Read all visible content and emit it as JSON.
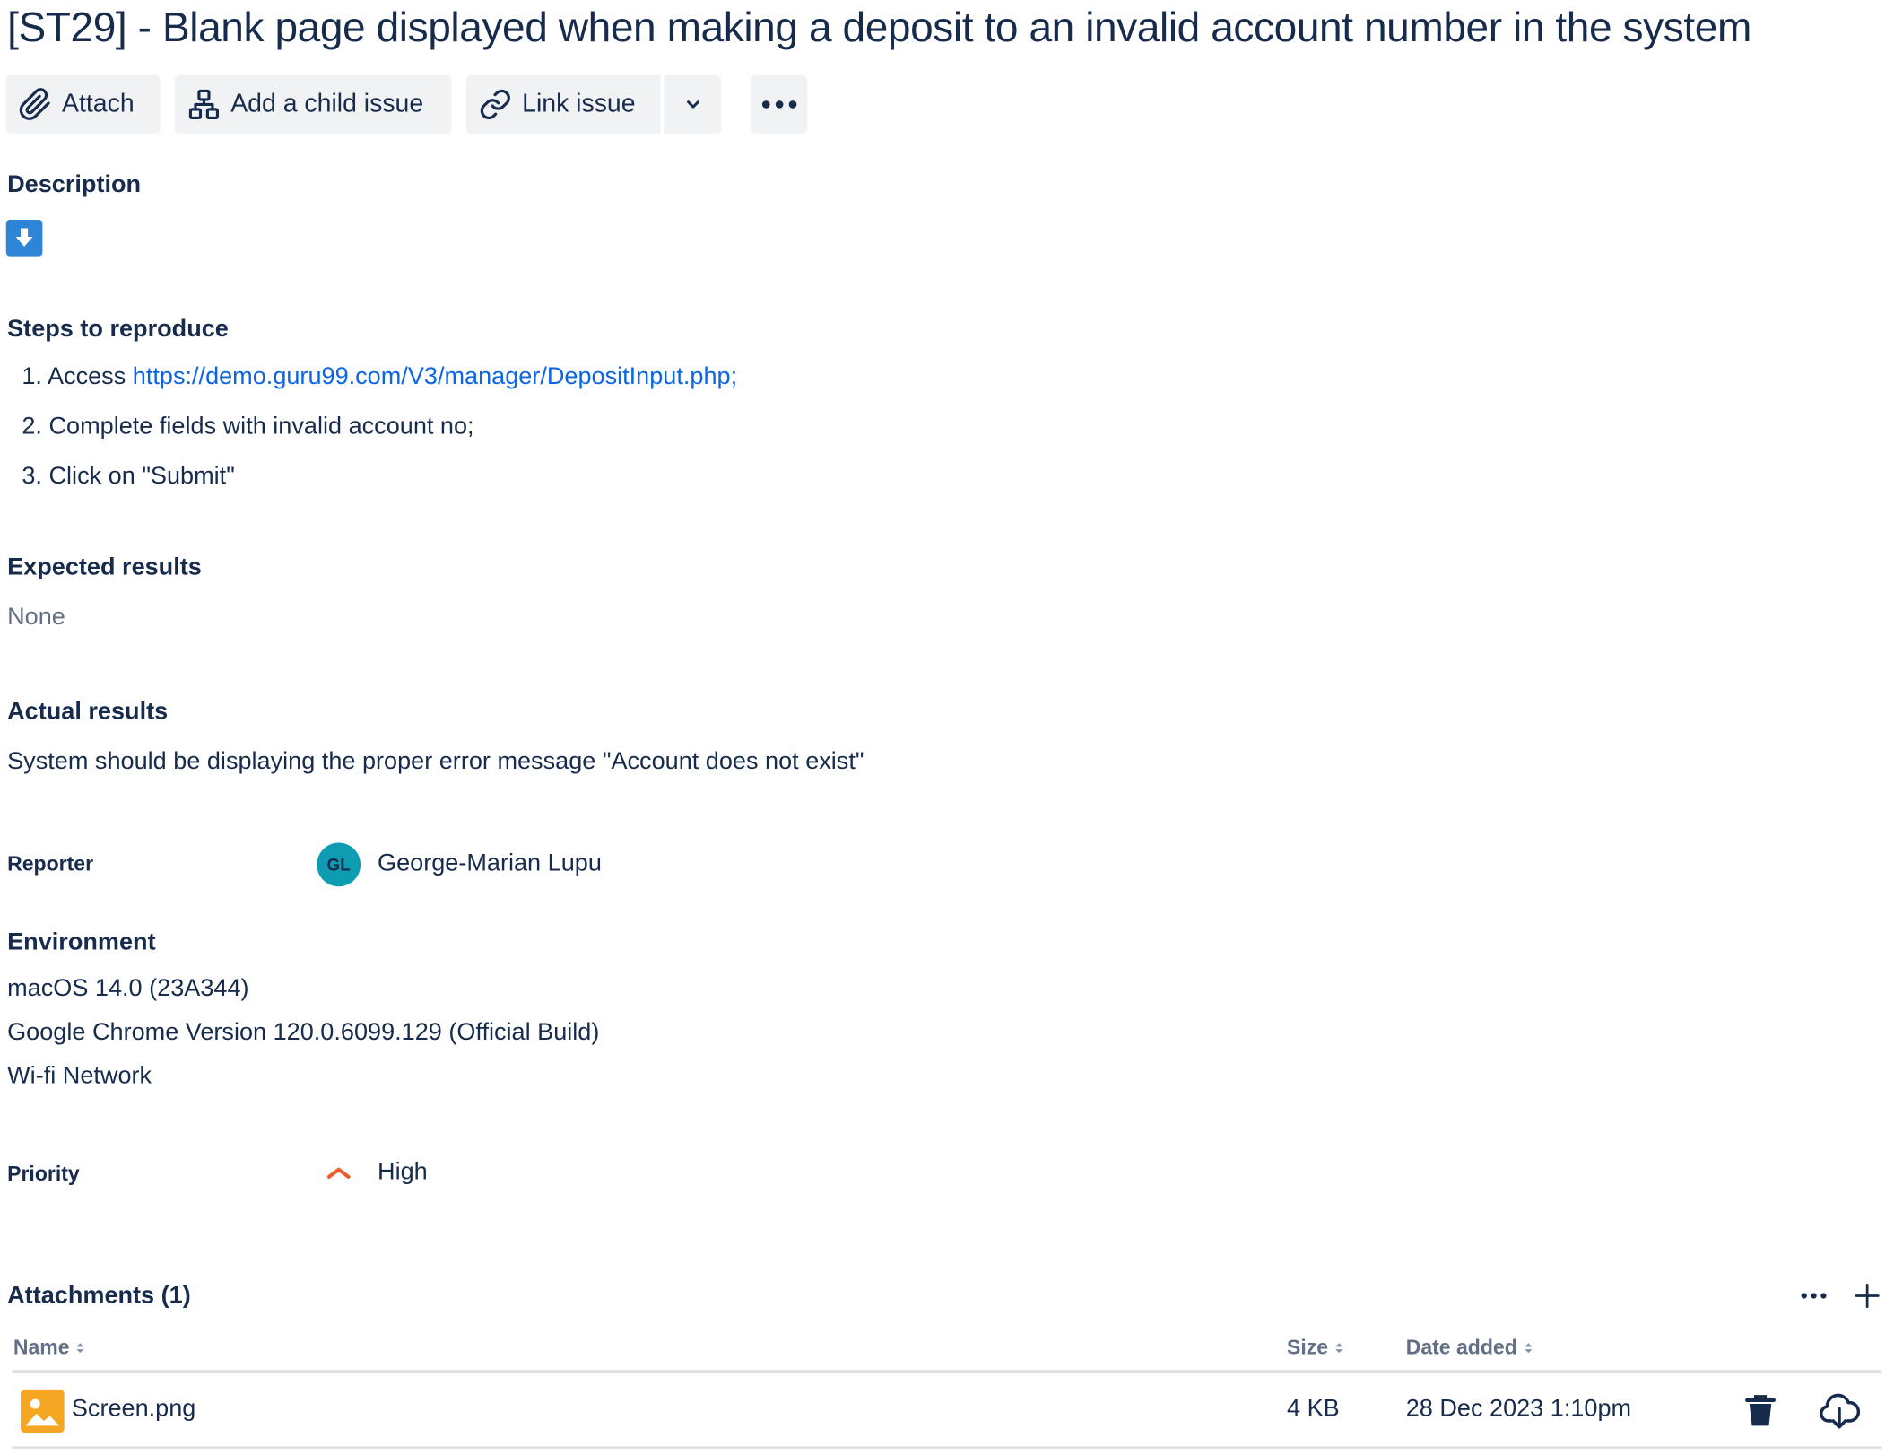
{
  "issue": {
    "title": "[ST29] - Blank page displayed when making a deposit to an invalid account number in the system"
  },
  "toolbar": {
    "attach_label": "Attach",
    "add_child_label": "Add a child issue",
    "link_issue_label": "Link issue"
  },
  "description": {
    "heading": "Description",
    "icon": "download-arrow-icon"
  },
  "steps": {
    "heading": "Steps to reproduce",
    "items": [
      {
        "num": "1.",
        "text": "Access ",
        "link": "https://demo.guru99.com/V3/manager/DepositInput.php;"
      },
      {
        "num": "2.",
        "text": "Complete fields with invalid account no;"
      },
      {
        "num": "3.",
        "text": "Click on \"Submit\""
      }
    ]
  },
  "expected": {
    "heading": "Expected results",
    "value": "None"
  },
  "actual": {
    "heading": "Actual results",
    "value": "System should be displaying the proper error message \"Account does not exist\""
  },
  "reporter": {
    "label": "Reporter",
    "initials": "GL",
    "name": "George-Marian Lupu",
    "avatar_color": "#0e9cb3"
  },
  "environment": {
    "heading": "Environment",
    "lines": [
      "macOS 14.0 (23A344)",
      "Google Chrome Version 120.0.6099.129 (Official Build)",
      "Wi-fi Network"
    ]
  },
  "priority": {
    "label": "Priority",
    "value": "High",
    "color": "#f15b2a"
  },
  "attachments": {
    "heading": "Attachments (1)",
    "columns": {
      "name": "Name",
      "size": "Size",
      "date": "Date added"
    },
    "rows": [
      {
        "name": "Screen.png",
        "size": "4 KB",
        "date": "28 Dec 2023 1:10pm",
        "icon": "image-file-icon"
      }
    ]
  },
  "colors": {
    "text": "#172b4d",
    "link": "#0c66e4",
    "button_bg": "#f1f2f4",
    "muted": "#626f86",
    "file_icon": "#f5a623"
  }
}
